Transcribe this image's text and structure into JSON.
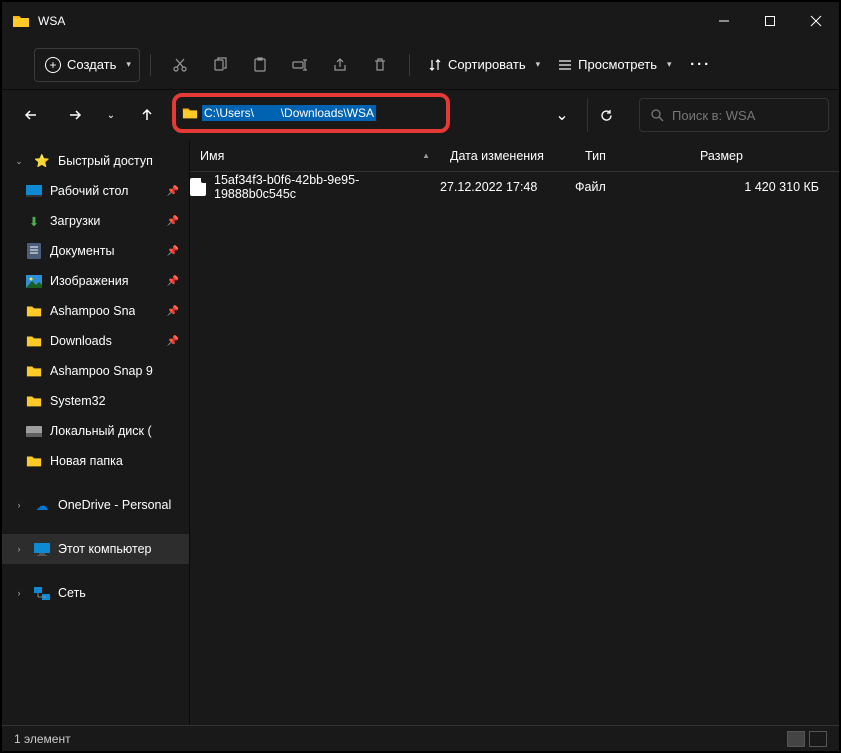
{
  "title": "WSA",
  "toolbar": {
    "new_label": "Создать",
    "sort_label": "Сортировать",
    "view_label": "Просмотреть"
  },
  "address": {
    "path_prefix": "C:\\Users\\",
    "path_suffix": "\\Downloads\\WSA"
  },
  "search": {
    "placeholder": "Поиск в: WSA"
  },
  "sidebar": {
    "quick_access": "Быстрый доступ",
    "items": [
      {
        "label": "Рабочий стол",
        "pinned": true
      },
      {
        "label": "Загрузки",
        "pinned": true
      },
      {
        "label": "Документы",
        "pinned": true
      },
      {
        "label": "Изображения",
        "pinned": true
      },
      {
        "label": "Ashampoo Sna",
        "pinned": true
      },
      {
        "label": "Downloads",
        "pinned": true
      },
      {
        "label": "Ashampoo Snap 9",
        "pinned": false
      },
      {
        "label": "System32",
        "pinned": false
      },
      {
        "label": "Локальный диск (",
        "pinned": false
      },
      {
        "label": "Новая папка",
        "pinned": false
      }
    ],
    "onedrive": "OneDrive - Personal",
    "this_pc": "Этот компьютер",
    "network": "Сеть"
  },
  "columns": {
    "name": "Имя",
    "date": "Дата изменения",
    "type": "Тип",
    "size": "Размер"
  },
  "files": [
    {
      "name": "15af34f3-b0f6-42bb-9e95-19888b0c545c",
      "date": "27.12.2022 17:48",
      "type": "Файл",
      "size": "1 420 310 КБ"
    }
  ],
  "status": {
    "count": "1 элемент"
  }
}
